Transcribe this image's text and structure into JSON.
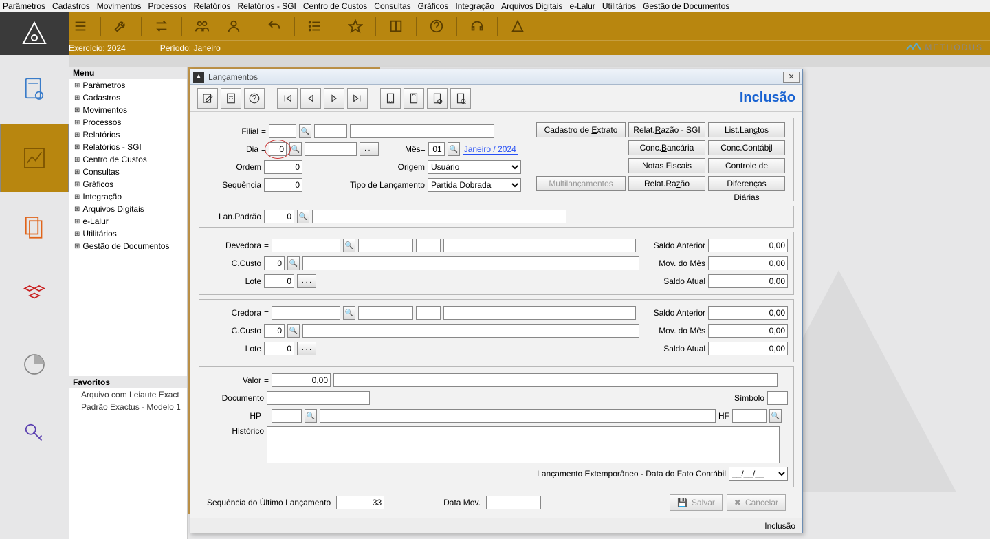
{
  "menubar": [
    "Parâmetros",
    "Cadastros",
    "Movimentos",
    "Processos",
    "Relatórios",
    "Relatórios - SGI",
    "Centro de Custos",
    "Consultas",
    "Gráficos",
    "Integração",
    "Arquivos Digitais",
    "e-Lalur",
    "Utilitários",
    "Gestão de Documentos"
  ],
  "menubar_hotkeys": [
    "P",
    "C",
    "M",
    "",
    "R",
    "",
    "",
    "C",
    "G",
    "",
    "A",
    "L",
    "U",
    "D"
  ],
  "infobar": {
    "exercicio_label": "Exercício:",
    "exercicio_value": "2024",
    "periodo_label": "Período:",
    "periodo_value": "Janeiro"
  },
  "methodus_label": "METHODUS",
  "sidenav": {
    "header": "Menu",
    "items": [
      "Parâmetros",
      "Cadastros",
      "Movimentos",
      "Processos",
      "Relatórios",
      "Relatórios - SGI",
      "Centro de Custos",
      "Consultas",
      "Gráficos",
      "Integração",
      "Arquivos Digitais",
      "e-Lalur",
      "Utilitários",
      "Gestão de Documentos"
    ],
    "fav_header": "Favoritos",
    "favorites": [
      "Arquivo com Leiaute Exact",
      "Padrão Exactus - Modelo 1"
    ]
  },
  "modal": {
    "title": "Lançamentos",
    "mode": "Inclusão",
    "labels": {
      "filial": "Filial",
      "dia": "Dia",
      "mes": "Mês=",
      "ordem": "Ordem",
      "sequencia": "Sequência",
      "origem": "Origem",
      "tipo": "Tipo de Lançamento",
      "lanpadrao": "Lan.Padrão",
      "devedora": "Devedora",
      "ccusto": "C.Custo",
      "lote": "Lote",
      "credora": "Credora",
      "saldo_anterior": "Saldo Anterior",
      "mov_mes": "Mov. do Mês",
      "saldo_atual": "Saldo Atual",
      "valor": "Valor",
      "documento": "Documento",
      "simbolo": "Símbolo",
      "hp": "HP",
      "hf": "HF",
      "historico": "Histórico",
      "extemporaneo": "Lançamento Extemporâneo - Data do Fato Contábil",
      "seq_ultimo": "Sequência do Último Lançamento",
      "data_mov": "Data Mov."
    },
    "values": {
      "filial": "",
      "dia": "0",
      "mes": "01",
      "mes_text": "Janeiro / 2024",
      "ordem": "0",
      "sequencia": "0",
      "origem": "Usuário",
      "tipo": "Partida Dobrada",
      "lanpadrao": "0",
      "dev": "",
      "dev_ccusto": "0",
      "dev_lote": "0",
      "dev_saldo_ant": "0,00",
      "dev_mov": "0,00",
      "dev_saldo": "0,00",
      "cred": "",
      "cred_ccusto": "0",
      "cred_lote": "0",
      "cred_saldo_ant": "0,00",
      "cred_mov": "0,00",
      "cred_saldo": "0,00",
      "valor": "0,00",
      "documento": "",
      "simbolo": "",
      "hp": "",
      "hf": "",
      "historico": "",
      "extemp": "__/__/__",
      "seq_ultimo": "33",
      "data_mov": ""
    },
    "buttons": {
      "cad_extrato": "Cadastro de Extrato",
      "relat_razao_sgi": "Relat.Razão - SGI",
      "list_lanctos": "List.Lançtos",
      "conc_banc": "Conc.Bancária",
      "conc_cont": "Conc.Contábil",
      "notas": "Notas Fiscais",
      "ctrl_baixas": "Controle de Baixas",
      "multi": "Multilançamentos",
      "relat_razao": "Relat.Razão",
      "dif_diarias": "Diferenças Diárias",
      "salvar": "Salvar",
      "cancelar": "Cancelar"
    },
    "status": "Inclusão"
  }
}
